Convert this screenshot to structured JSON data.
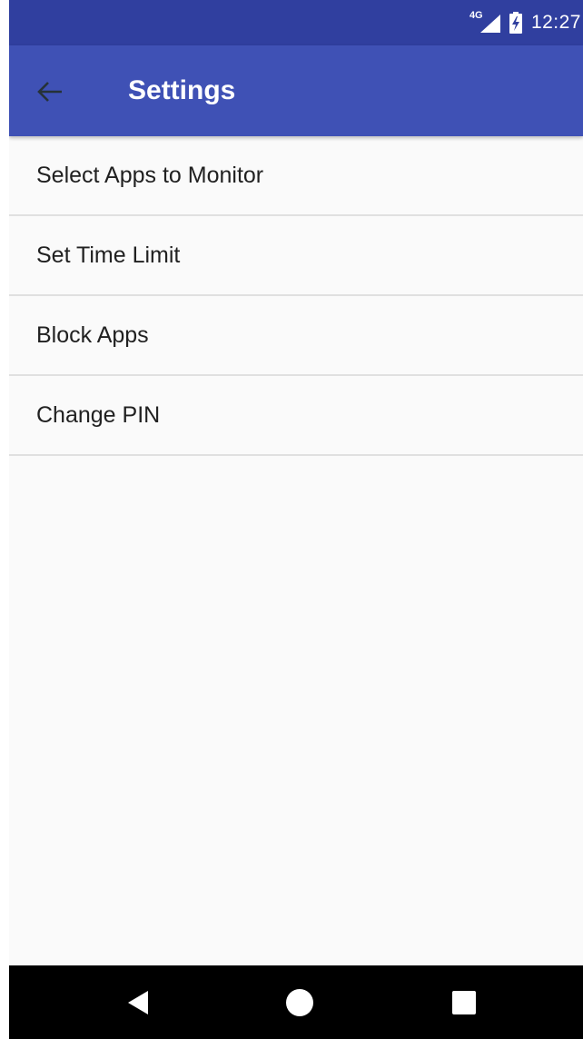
{
  "status_bar": {
    "network_label": "4G",
    "time": "12:27",
    "icons": [
      "signal-icon",
      "battery-charging-icon"
    ]
  },
  "app_bar": {
    "title": "Settings",
    "back_icon": "back-arrow-icon",
    "background_color": "#3f51b5",
    "status_color": "#303f9f"
  },
  "settings": {
    "items": [
      {
        "label": "Select Apps to Monitor"
      },
      {
        "label": "Set Time Limit"
      },
      {
        "label": "Block Apps"
      },
      {
        "label": "Change PIN"
      }
    ]
  },
  "nav_bar": {
    "icons": [
      "back-icon",
      "home-icon",
      "recents-icon"
    ]
  }
}
